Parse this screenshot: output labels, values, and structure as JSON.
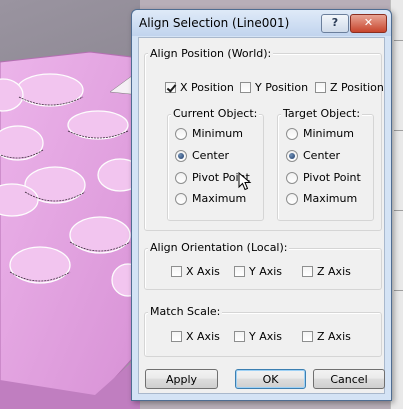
{
  "dialog": {
    "title": "Align Selection (Line001)",
    "help_label": "?",
    "close_label": "✕"
  },
  "align_position": {
    "label": "Align Position (World):",
    "x": {
      "label": "X Position",
      "checked": true
    },
    "y": {
      "label": "Y Position",
      "checked": false
    },
    "z": {
      "label": "Z Position",
      "checked": false
    }
  },
  "current_object": {
    "label": "Current Object:",
    "options": [
      "Minimum",
      "Center",
      "Pivot Point",
      "Maximum"
    ],
    "selected": "Center"
  },
  "target_object": {
    "label": "Target Object:",
    "options": [
      "Minimum",
      "Center",
      "Pivot Point",
      "Maximum"
    ],
    "selected": "Center"
  },
  "align_orientation": {
    "label": "Align Orientation (Local):",
    "x": "X Axis",
    "y": "Y Axis",
    "z": "Z Axis"
  },
  "match_scale": {
    "label": "Match Scale:",
    "x": "X Axis",
    "y": "Y Axis",
    "z": "Z Axis"
  },
  "buttons": {
    "apply": "Apply",
    "ok": "OK",
    "cancel": "Cancel"
  },
  "colors": {
    "viewport_surface": "#e7a8e3",
    "dialog_frame": "#d4e3f5",
    "client_bg": "#f0f0f0",
    "close_red": "#c8452d"
  }
}
